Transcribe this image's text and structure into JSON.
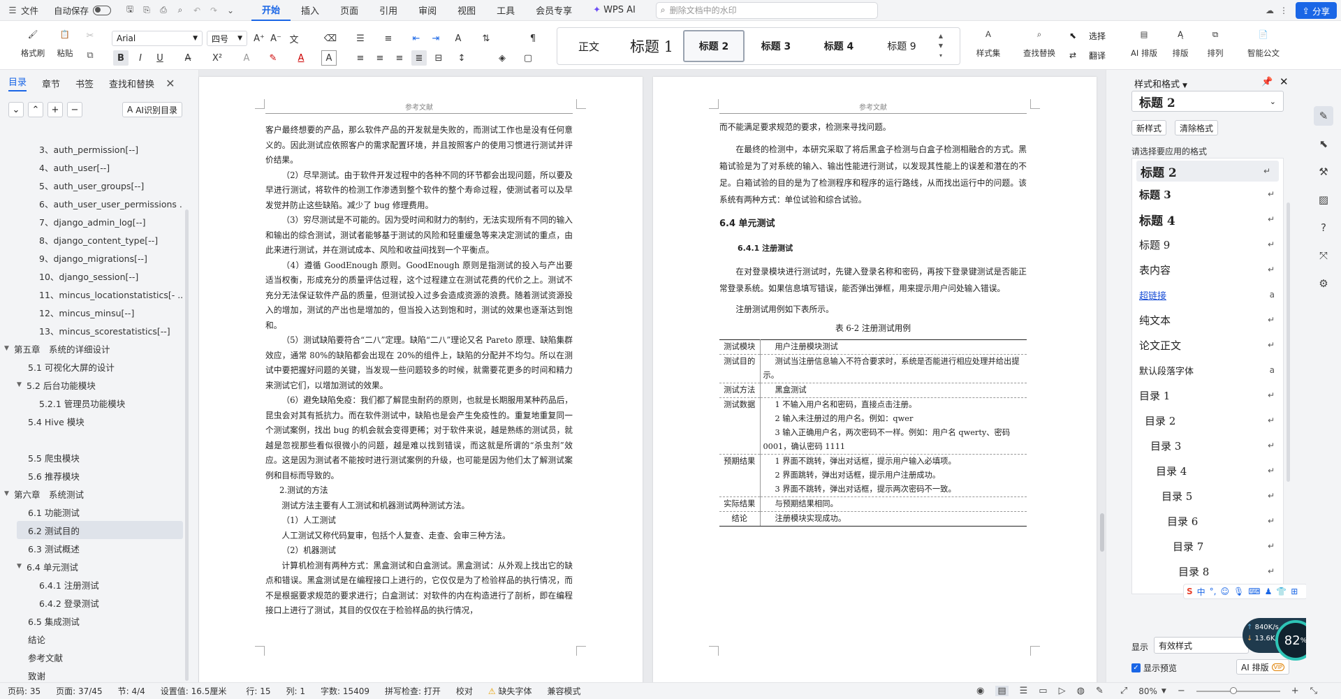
{
  "titlebar": {
    "file": "文件",
    "autosave": "自动保存",
    "tabs": [
      "开始",
      "插入",
      "页面",
      "引用",
      "审阅",
      "视图",
      "工具",
      "会员专享",
      "WPS AI"
    ],
    "active_tab": "开始",
    "search_placeholder": "删除文档中的水印",
    "share": "分享"
  },
  "ribbon": {
    "format_painter": "格式刷",
    "paste": "粘贴",
    "font_name": "Arial",
    "font_size": "四号",
    "styles": [
      "正文",
      "标题 1",
      "标题 2",
      "标题 3",
      "标题 4",
      "标题 9"
    ],
    "selected_style": "标题 2",
    "style_set": "样式集",
    "find_replace": "查找替换",
    "select": "选择",
    "translate": "翻译",
    "ai_layout": "AI 排版",
    "layout": "排版",
    "arrange": "排列",
    "smart_doc": "智能公文"
  },
  "left_pane": {
    "tabs": [
      "目录",
      "章节",
      "书签",
      "查找和替换"
    ],
    "ai_button": "AI识别目录",
    "toc": [
      {
        "label": "3、auth_permission[--]",
        "level": 2
      },
      {
        "label": "4、auth_user[--]",
        "level": 2
      },
      {
        "label": "5、auth_user_groups[--]",
        "level": 2
      },
      {
        "label": "6、auth_user_user_permissions ...",
        "level": 2
      },
      {
        "label": "7、django_admin_log[--]",
        "level": 2
      },
      {
        "label": "8、django_content_type[--]",
        "level": 2
      },
      {
        "label": "9、django_migrations[--]",
        "level": 2
      },
      {
        "label": "10、django_session[--]",
        "level": 2
      },
      {
        "label": "11、mincus_locationstatistics[- ...",
        "level": 2
      },
      {
        "label": "12、mincus_minsu[--]",
        "level": 2
      },
      {
        "label": "13、mincus_scorestatistics[--]",
        "level": 2
      },
      {
        "label": "第五章　系统的详细设计",
        "level": 0,
        "caret": true
      },
      {
        "label": "5.1 可视化大屏的设计",
        "level": 1
      },
      {
        "label": "5.2 后台功能模块",
        "level": 1,
        "caret": true
      },
      {
        "label": "5.2.1 管理员功能模块",
        "level": 2
      },
      {
        "label": "5.4 Hive 模块",
        "level": 1
      },
      {
        "label": "",
        "level": 1
      },
      {
        "label": "5.5 爬虫模块",
        "level": 1
      },
      {
        "label": "5.6 推荐模块",
        "level": 1
      },
      {
        "label": "第六章　系统测试",
        "level": 0,
        "caret": true
      },
      {
        "label": "6.1 功能测试",
        "level": 1
      },
      {
        "label": "6.2 测试目的",
        "level": 1,
        "selected": true
      },
      {
        "label": "6.3 测试概述",
        "level": 1
      },
      {
        "label": "6.4 单元测试",
        "level": 1,
        "caret": true
      },
      {
        "label": "6.4.1 注册测试",
        "level": 2
      },
      {
        "label": "6.4.2 登录测试",
        "level": 2
      },
      {
        "label": "6.5 集成测试",
        "level": 1
      },
      {
        "label": "结论",
        "level": -1
      },
      {
        "label": "参考文献",
        "level": -1
      },
      {
        "label": "致谢",
        "level": -1
      }
    ]
  },
  "page_left": {
    "header": "参考文献",
    "paragraphs": [
      {
        "t": "客户最终想要的产品，那么软件产品的开发就是失败的，而测试工作也是没有任何意义的。因此测试应依照客户的需求配置环境，并且按照客户的使用习惯进行测试并评价结果。",
        "ni": true
      },
      {
        "t": "（2）尽早测试。由于软件开发过程中的各种不同的环节都会出现问题，所以要及早进行测试，将软件的检测工作渗透到整个软件的整个寿命过程，使测试者可以及早发觉并防止这些缺陷。减少了 bug 修理费用。"
      },
      {
        "t": "（3）穷尽测试是不可能的。因为受时间和财力的制约，无法实现所有不同的输入和输出的综合测试，测试者能够基于测试的风险和轻重缓急等来决定测试的重点，由此来进行测试，并在测试成本、风险和收益间找到一个平衡点。"
      },
      {
        "t": "（4）遵循 GoodEnough 原则。GoodEnough 原则是指测试的投入与产出要适当权衡，形成充分的质量评估过程，这个过程建立在测试花费的代价之上。测试不充分无法保证软件产品的质量，但测试投入过多会造成资源的浪费。随着测试资源投入的增加，测试的产出也是增加的，但当投入达到饱和时，测试的效果也逐渐达到饱和。"
      },
      {
        "t": "（5）测试缺陷要符合“二八”定理。缺陷“二八”理论又名 Pareto 原理、缺陷集群效应，通常 80%的缺陷都会出现在 20%的组件上，缺陷的分配并不均匀。所以在测试中要把握好问题的关键，当发现一些问题较多的时候，就需要花更多的时间和精力来测试它们，以增加测试的效果。"
      },
      {
        "t": "（6）避免缺陷免疫：我们都了解昆虫耐药的原则，也就是长期服用某种药品后，昆虫会对其有抵抗力。而在软件测试中，缺陷也是会产生免疫性的。重复地重复同一个测试案例，找出 bug 的机会就会变得更稀；对于软件来说，越是熟练的测试员，就越是忽视那些看似很微小的问题，越是难以找到错误，而这就是所谓的“杀虫剂”效应。这是因为测试者不能按时进行测试案例的升级，也可能是因为他们太了解测试案例和目标而导致的。"
      },
      {
        "t": "2.测试的方法",
        "ni": true,
        "ind": 20
      },
      {
        "t": "测试方法主要有人工测试和机器测试两种测试方法。"
      },
      {
        "t": "（1）人工测试"
      },
      {
        "t": "人工测试又称代码复审，包括个人复查、走查、会审三种方法。"
      },
      {
        "t": "（2）机器测试"
      },
      {
        "t": "计算机检测有两种方式：黑盒测试和白盒测试。黑盒测试：从外观上找出它的缺点和错误。黑盒测试是在编程接口上进行的，它仅仅是为了检验样品的执行情况，而不是根据要求规范的要求进行；白盒测试：对软件的内在构造进行了剖析，即在编程接口上进行了测试，其目的仅仅在于检验样品的执行情况，"
      }
    ]
  },
  "page_right": {
    "header": "参考文献",
    "para1": "而不能满足要求规范的要求，检测来寻找问题。",
    "para2": "在最终的检测中，本研究采取了将后黑盒子检测与白盒子检测相融合的方式。黑箱试验是为了对系统的输入、输出性能进行测试，以发现其性能上的误差和潜在的不足。白箱试验的目的是为了检测程序和程序的运行路线，从而找出运行中的问题。该系统有两种方式：单位试验和综合试验。",
    "h2": "6.4  单元测试",
    "h3": "6.4.1  注册测试",
    "para3": "在对登录模块进行测试时，先键入登录名称和密码，再按下登录键测试是否能正常登录系统。如果信息填写错误，能否弹出弹框，用来提示用户问处输入错误。",
    "para4": "注册测试用例如下表所示。",
    "table_caption": "表 6-2 注册测试用例",
    "table": [
      {
        "k": "测试模块",
        "v": [
          "用户注册模块测试"
        ]
      },
      {
        "k": "测试目的",
        "v": [
          "测试当注册信息输入不符合要求时，系统是否能进行相应处理并给出提示。"
        ]
      },
      {
        "k": "测试方法",
        "v": [
          "黑盒测试"
        ]
      },
      {
        "k": "测试数据",
        "v": [
          "1 不输入用户名和密码，直接点击注册。",
          "2 输入未注册过的用户名。例如：qwer",
          "3 输入正确用户名，两次密码不一样。例如：用户名 qwerty、密码 0001，确认密码 1111"
        ]
      },
      {
        "k": "预期结果",
        "v": [
          "1 界面不跳转，弹出对话框，提示用户输入必填项。",
          "2 界面跳转，弹出对话框，提示用户注册成功。",
          "3 界面不跳转，弹出对话框，提示两次密码不一致。"
        ]
      },
      {
        "k": "实际结果",
        "v": [
          "与预期结果相同。"
        ]
      },
      {
        "k": "结论",
        "v": [
          "注册模块实现成功。"
        ]
      }
    ]
  },
  "right_pane": {
    "title": "样式和格式",
    "current_style": "标题 2",
    "new_style": "新样式",
    "clear_format": "清除格式",
    "apply_label": "请选择要应用的格式",
    "styles": [
      {
        "label": "标题 2",
        "fs": 17,
        "bold": true,
        "icon": "↵",
        "sel": true
      },
      {
        "label": "标题 3",
        "fs": 15,
        "bold": true,
        "icon": "↵"
      },
      {
        "label": "标题 4",
        "fs": 17,
        "bold": true,
        "icon": "↵"
      },
      {
        "label": "标题 9",
        "fs": 15,
        "icon": "↵"
      },
      {
        "label": "表内容",
        "fs": 15,
        "icon": "↵"
      },
      {
        "label": "超链接",
        "fs": 13,
        "link": true,
        "icon": "a"
      },
      {
        "label": "纯文本",
        "fs": 15,
        "icon": "↵"
      },
      {
        "label": "论文正文",
        "fs": 15,
        "icon": "↵"
      },
      {
        "label": "默认段落字体",
        "fs": 13,
        "icon": "a"
      },
      {
        "label": "目录 1",
        "fs": 15,
        "ind": 0,
        "icon": "↵"
      },
      {
        "label": "目录 2",
        "fs": 15,
        "ind": 8,
        "icon": "↵"
      },
      {
        "label": "目录 3",
        "fs": 15,
        "ind": 16,
        "icon": "↵"
      },
      {
        "label": "目录 4",
        "fs": 15,
        "ind": 24,
        "icon": "↵"
      },
      {
        "label": "目录 5",
        "fs": 15,
        "ind": 32,
        "icon": "↵"
      },
      {
        "label": "目录 6",
        "fs": 15,
        "ind": 40,
        "icon": "↵"
      },
      {
        "label": "目录 7",
        "fs": 15,
        "ind": 48,
        "icon": "↵"
      },
      {
        "label": "目录 8",
        "fs": 15,
        "ind": 56,
        "icon": "↵"
      }
    ],
    "show_label": "显示",
    "show_value": "有效样式",
    "preview_label": "显示预览",
    "ai_layout": "AI 排版",
    "net_up": "840K/s",
    "net_down": "13.6K/s",
    "percent": "82"
  },
  "statusbar": {
    "items": [
      "页码: 35",
      "页面: 37/45",
      "节: 4/4",
      "设置值: 16.5厘米",
      "行: 15",
      "列: 1",
      "字数: 15409",
      "拼写检查: 打开",
      "校对",
      "缺失字体",
      "兼容模式"
    ],
    "zoom": "80%"
  },
  "colors": {
    "accent": "#1a66e6",
    "ribbon_bg": "#ffffff",
    "chrome_bg": "#f3f4f6"
  }
}
